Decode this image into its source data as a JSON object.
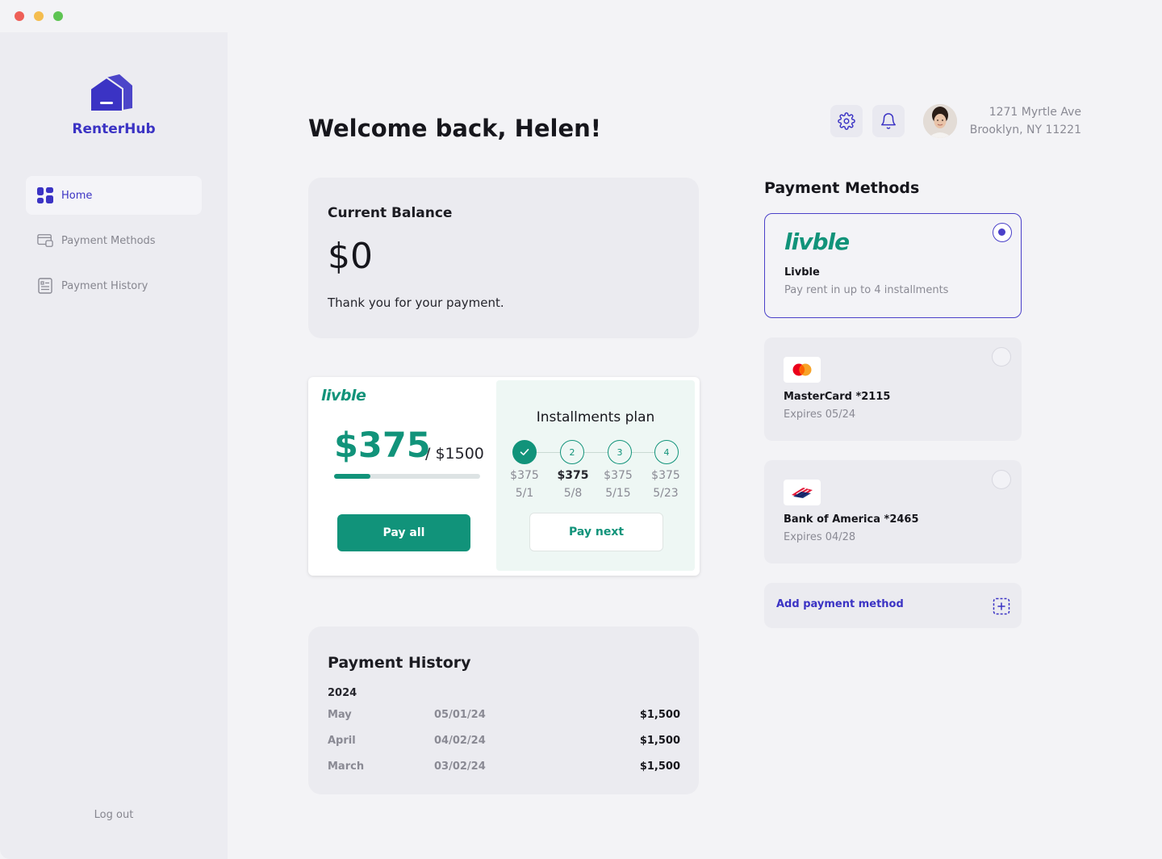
{
  "app": {
    "name": "RenterHub"
  },
  "sidebar": {
    "items": [
      {
        "label": "Home",
        "icon": "dashboard-icon",
        "active": true
      },
      {
        "label": "Payment Methods",
        "icon": "card-icon",
        "active": false
      },
      {
        "label": "Payment History",
        "icon": "receipt-icon",
        "active": false
      }
    ],
    "logout_label": "Log out"
  },
  "header": {
    "title": "Welcome back, Helen!",
    "address_line1": "1271 Myrtle Ave",
    "address_line2": "Brooklyn, NY 11221",
    "settings_icon": "gear-icon",
    "notifications_icon": "bell-icon"
  },
  "balance": {
    "title": "Current Balance",
    "value": "$0",
    "note": "Thank you for your payment."
  },
  "livble": {
    "logo_text": "livble",
    "amount": "$375",
    "total": "/ $1500",
    "paid_fraction": 0.25,
    "pay_all_label": "Pay all",
    "plan_title": "Installments plan",
    "steps": [
      {
        "num": "",
        "amount": "$375",
        "date": "5/1",
        "status": "done"
      },
      {
        "num": "2",
        "amount": "$375",
        "date": "5/8",
        "status": "current"
      },
      {
        "num": "3",
        "amount": "$375",
        "date": "5/15",
        "status": "upcoming"
      },
      {
        "num": "4",
        "amount": "$375",
        "date": "5/23",
        "status": "upcoming"
      }
    ],
    "pay_next_label": "Pay next"
  },
  "history": {
    "title": "Payment History",
    "year": "2024",
    "rows": [
      {
        "month": "May",
        "date": "05/01/24",
        "amount": "$1,500"
      },
      {
        "month": "April",
        "date": "04/02/24",
        "amount": "$1,500"
      },
      {
        "month": "March",
        "date": "03/02/24",
        "amount": "$1,500"
      }
    ]
  },
  "payment_methods": {
    "title": "Payment Methods",
    "methods": [
      {
        "logo": "livble",
        "name": "Livble",
        "sub": "Pay rent in up to 4 installments",
        "selected": true
      },
      {
        "logo": "mastercard-icon",
        "name": "MasterCard *2115",
        "sub": "Expires 05/24",
        "selected": false
      },
      {
        "logo": "bank-of-america-icon",
        "name": "Bank of America *2465",
        "sub": "Expires 04/28",
        "selected": false
      }
    ],
    "add_label": "Add payment method"
  },
  "colors": {
    "brand": "#3b33c4",
    "livble_green": "#11937a",
    "background": "#f3f3f6",
    "sidebar": "#ececf1"
  }
}
